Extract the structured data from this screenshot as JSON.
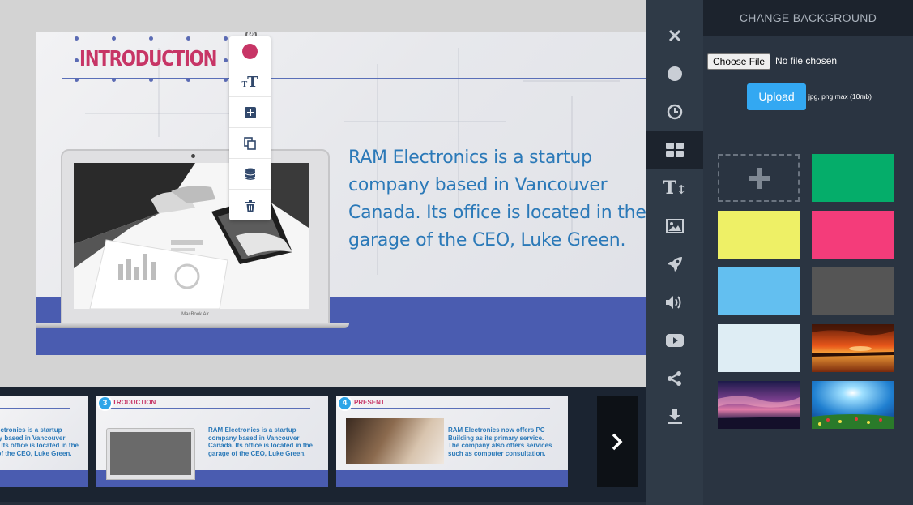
{
  "slide": {
    "title": "INTRODUCTION",
    "body": "RAM Electronics is a startup company based in Vancouver Canada. Its office is located in the garage of the CEO, Luke Green.",
    "laptop_brand": "MacBook Air"
  },
  "toolbar": {
    "items": [
      {
        "name": "color",
        "icon": "color-dot-icon",
        "color": "#c73566"
      },
      {
        "name": "text-size",
        "icon": "text-size-icon"
      },
      {
        "name": "add",
        "icon": "plus-square-icon"
      },
      {
        "name": "duplicate",
        "icon": "copy-icon"
      },
      {
        "name": "layer",
        "icon": "database-icon"
      },
      {
        "name": "delete",
        "icon": "trash-icon"
      }
    ]
  },
  "filmstrip": {
    "slides": [
      {
        "number": "",
        "title": "",
        "text": "RAM Electronics is a startup company based in Vancouver Canada. Its office is located in the garage of the CEO, Luke Green."
      },
      {
        "number": "3",
        "title": "INTRODUCTION",
        "text": "RAM Electronics is a startup company based in Vancouver Canada. Its office is located in the garage of the CEO, Luke Green."
      },
      {
        "number": "4",
        "title": "PRESENT",
        "text": "RAM Electronics now offers PC Building as its primary service. The company also offers services such as computer consultation."
      }
    ],
    "next_icon": "chevron-right-icon"
  },
  "rail": {
    "items": [
      "close-icon",
      "circle-icon",
      "clock-icon",
      "grid-icon",
      "text-resize-icon",
      "image-icon",
      "rocket-icon",
      "volume-icon",
      "youtube-icon",
      "share-icon",
      "download-icon"
    ],
    "active": "grid-icon"
  },
  "background_panel": {
    "title": "CHANGE BACKGROUND",
    "choose_file_label": "Choose File",
    "file_status": "No file chosen",
    "upload_label": "Upload",
    "upload_hint": "jpg, png max (10mb)",
    "swatches": [
      {
        "type": "add"
      },
      {
        "type": "color",
        "value": "#05ad6a"
      },
      {
        "type": "color",
        "value": "#eef066"
      },
      {
        "type": "color",
        "value": "#f43c7a"
      },
      {
        "type": "color",
        "value": "#63bff0"
      },
      {
        "type": "color",
        "value": "#555555"
      },
      {
        "type": "color",
        "value": "#deedf4"
      },
      {
        "type": "image",
        "value": "sunset-lake"
      },
      {
        "type": "image",
        "value": "purple-sky"
      },
      {
        "type": "image",
        "value": "sun-flower-field"
      }
    ]
  }
}
